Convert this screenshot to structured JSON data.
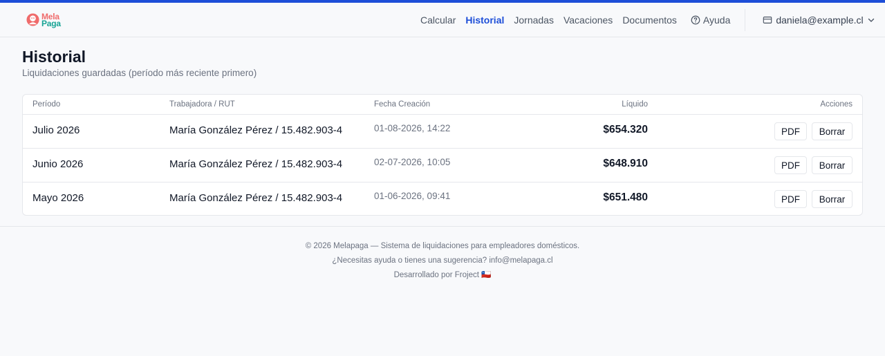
{
  "brand": {
    "line1": "Mela",
    "line2": "Paga",
    "color_red": "#ef6b6b",
    "color_teal": "#16a394"
  },
  "nav": {
    "items": [
      {
        "label": "Calcular",
        "active": false
      },
      {
        "label": "Historial",
        "active": true
      },
      {
        "label": "Jornadas",
        "active": false
      },
      {
        "label": "Vacaciones",
        "active": false
      },
      {
        "label": "Documentos",
        "active": false
      }
    ],
    "help_label": "Ayuda",
    "account_email": "daniela@example.cl"
  },
  "page": {
    "title": "Historial",
    "subtitle": "Liquidaciones guardadas (período más reciente primero)"
  },
  "table": {
    "headers": {
      "period": "Período",
      "worker": "Trabajadora / RUT",
      "created": "Fecha Creación",
      "net": "Líquido",
      "actions": "Acciones"
    },
    "rows": [
      {
        "period": "Julio 2026",
        "worker": "María González Pérez / 15.482.903-4",
        "created": "01-08-2026, 14:22",
        "net": "$654.320",
        "pdf": "PDF",
        "delete": "Borrar"
      },
      {
        "period": "Junio 2026",
        "worker": "María González Pérez / 15.482.903-4",
        "created": "02-07-2026, 10:05",
        "net": "$648.910",
        "pdf": "PDF",
        "delete": "Borrar"
      },
      {
        "period": "Mayo 2026",
        "worker": "María González Pérez / 15.482.903-4",
        "created": "01-06-2026, 09:41",
        "net": "$651.480",
        "pdf": "PDF",
        "delete": "Borrar"
      }
    ]
  },
  "footer": {
    "line1": "© 2026 Melapaga — Sistema de liquidaciones para empleadores domésticos.",
    "line2": "¿Necesitas ayuda o tienes una sugerencia? info@melapaga.cl",
    "line3": "Desarrollado por Froject 🇨🇱"
  },
  "colors": {
    "accent": "#1d4ed8",
    "border": "#e5e7eb",
    "muted": "#6b7280"
  }
}
